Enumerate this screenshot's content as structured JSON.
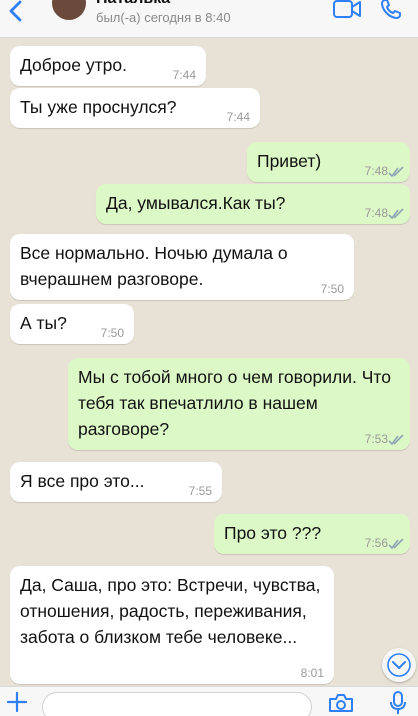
{
  "header": {
    "contact_name": "Наталька",
    "status": "был(-а) сегодня в 8:40",
    "icons": [
      "back-icon",
      "video-call-icon",
      "phone-icon"
    ]
  },
  "messages": [
    {
      "direction": "in",
      "text": "Доброе утро.",
      "time": "7:44"
    },
    {
      "direction": "in",
      "text": "Ты уже проснулся?",
      "time": "7:44"
    },
    {
      "direction": "out",
      "text": "Привет)",
      "time": "7:48",
      "read": true
    },
    {
      "direction": "out",
      "text": "Да, умывался.Как ты?",
      "time": "7:48",
      "read": true
    },
    {
      "direction": "in",
      "text": "Все нормально. Ночью думала о вчерашнем разговоре.",
      "time": "7:50"
    },
    {
      "direction": "in",
      "text": "А ты?",
      "time": "7:50"
    },
    {
      "direction": "out",
      "text": "Мы с тобой много о чем говорили. Что тебя так впечатлило в нашем разговоре?",
      "time": "7:53",
      "read": true
    },
    {
      "direction": "in",
      "text": "Я все про это...",
      "time": "7:55"
    },
    {
      "direction": "out",
      "text": "Про это ???",
      "time": "7:56",
      "read": true
    },
    {
      "direction": "in",
      "text": "Да, Саша, про это: Встречи, чувства, отношения, радость, переживания, забота о близком тебе человеке...",
      "time": "8:01"
    }
  ],
  "input": {
    "value": "",
    "icons": [
      "plus-icon",
      "camera-icon",
      "microphone-icon"
    ]
  },
  "colors": {
    "background": "#e8e1d6",
    "incoming": "#ffffff",
    "outgoing": "#dcf8c6",
    "accent": "#2f7ff6",
    "read_ticks": "#8fa6b5"
  }
}
